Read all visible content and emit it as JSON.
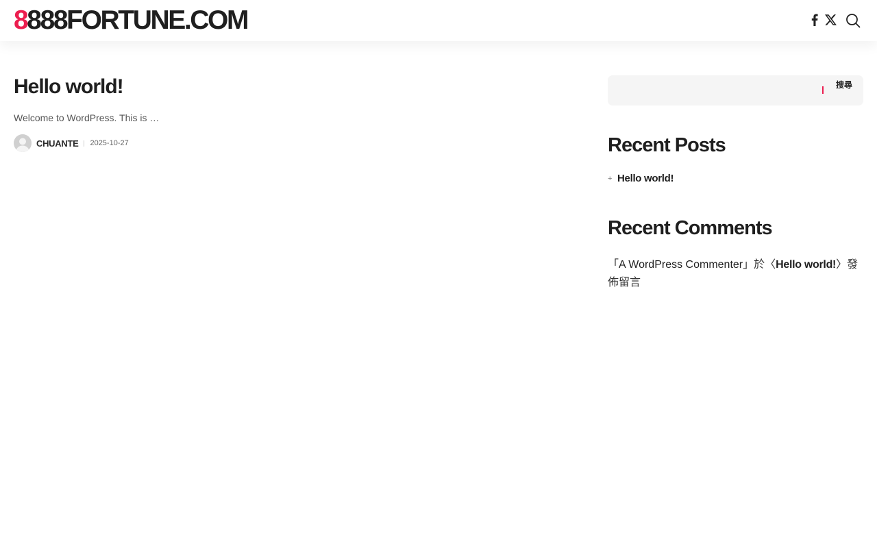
{
  "site": {
    "logo_accent": "8",
    "logo_rest": "888FORTUNE.COM",
    "accent_color": "#ec1e4f"
  },
  "header": {
    "icons": [
      "facebook-icon",
      "x-twitter-icon",
      "search-icon"
    ]
  },
  "post": {
    "title": "Hello world!",
    "excerpt": "Welcome to WordPress. This is …",
    "author": "CHUANTE",
    "date": "2025-10-27"
  },
  "sidebar": {
    "search": {
      "placeholder": "",
      "button_label": "搜尋"
    },
    "recent_posts": {
      "title": "Recent Posts",
      "items": [
        {
          "label": "Hello world!"
        }
      ]
    },
    "recent_comments": {
      "title": "Recent Comments",
      "items": [
        {
          "open": "「",
          "author": "A WordPress Commenter",
          "mid": "」於〈",
          "post": "Hello world!",
          "close": "〉發佈留言"
        }
      ]
    }
  }
}
